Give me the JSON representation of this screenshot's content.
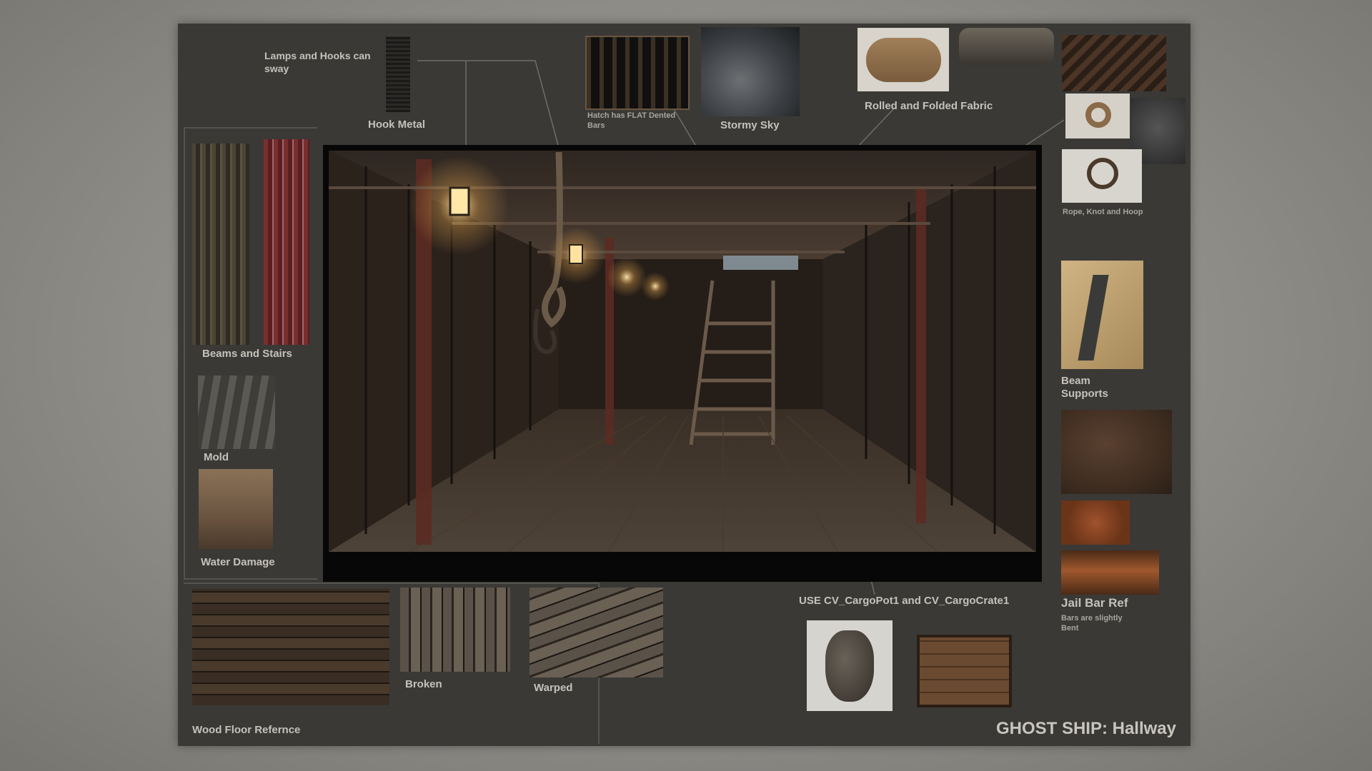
{
  "title": "GHOST SHIP: Hallway",
  "labels": {
    "lamps_hooks": "Lamps and Hooks can sway",
    "hook_metal": "Hook Metal",
    "hatch_bars": "Hatch has FLAT Dented Bars",
    "stormy_sky": "Stormy Sky",
    "fabric": "Rolled and Folded Fabric",
    "rope": "Rope, Knot and Hoop",
    "beams_stairs": "Beams and Stairs",
    "mold": "Mold",
    "water_damage": "Water Damage",
    "beam_supports": "Beam Supports",
    "jail_bar_ref": "Jail Bar Ref",
    "jail_bar_note": "Bars are slightly Bent",
    "cargo": "USE CV_CargoPot1 and CV_CargoCrate1",
    "broken": "Broken",
    "warped": "Warped",
    "wood_floor": "Wood Floor Refernce"
  }
}
